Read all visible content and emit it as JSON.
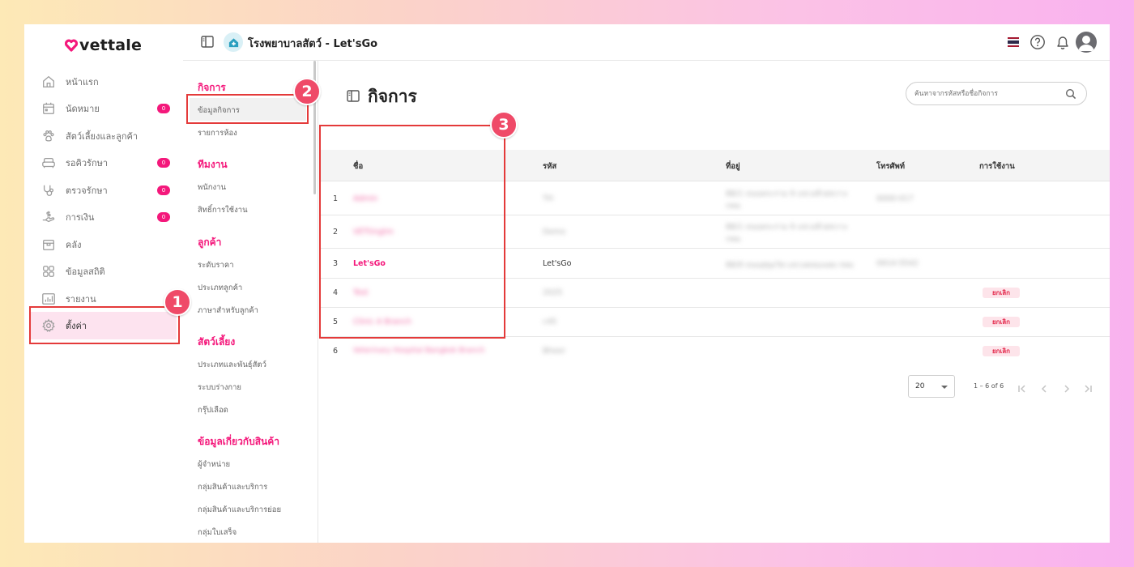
{
  "brand": {
    "logo_text": "vettale"
  },
  "nav": {
    "items": [
      {
        "label": "หน้าแรก",
        "icon": "home-icon"
      },
      {
        "label": "นัดหมาย",
        "icon": "calendar-icon",
        "badge": "0"
      },
      {
        "label": "สัตว์เลี้ยงและลูกค้า",
        "icon": "paw-icon"
      },
      {
        "label": "รอคิวรักษา",
        "icon": "sofa-icon",
        "badge": "0"
      },
      {
        "label": "ตรวจรักษา",
        "icon": "stethoscope-icon",
        "badge": "0"
      },
      {
        "label": "การเงิน",
        "icon": "money-hand-icon",
        "badge": "0"
      },
      {
        "label": "คลัง",
        "icon": "box-icon"
      },
      {
        "label": "ข้อมูลสถิติ",
        "icon": "grid-icon"
      },
      {
        "label": "รายงาน",
        "icon": "bar-chart-icon"
      },
      {
        "label": "ตั้งค่า",
        "icon": "gear-icon"
      }
    ]
  },
  "topbar": {
    "clinic_title": "โรงพยาบาลสัตว์ - Let'sGo"
  },
  "submenu": {
    "sections": [
      {
        "title": "กิจการ",
        "items": [
          "ข้อมูลกิจการ",
          "รายการห้อง"
        ]
      },
      {
        "title": "ทีมงาน",
        "items": [
          "พนักงาน",
          "สิทธิ์การใช้งาน"
        ]
      },
      {
        "title": "ลูกค้า",
        "items": [
          "ระดับราคา",
          "ประเภทลูกค้า",
          "ภาษาสำหรับลูกค้า"
        ]
      },
      {
        "title": "สัตว์เลี้ยง",
        "items": [
          "ประเภทและพันธุ์สัตว์",
          "ระบบร่างกาย",
          "กรุ๊ปเลือด"
        ]
      },
      {
        "title": "ข้อมูลเกี่ยวกับสินค้า",
        "items": [
          "ผู้จำหน่าย",
          "กลุ่มสินค้าและบริการ",
          "กลุ่มสินค้าและบริการย่อย",
          "กลุ่มใบเสร็จ"
        ]
      }
    ]
  },
  "main": {
    "title": "กิจการ",
    "search_placeholder": "ค้นหาจากรหัสหรือชื่อกิจการ",
    "columns": [
      "ชื่อ",
      "รหัส",
      "ที่อยู่",
      "โทรศัพท์",
      "การใช้งาน"
    ],
    "rows": [
      {
        "no": "1",
        "name": "Admin",
        "code": "TH",
        "address": "88/1 ถนนพระราม 9 แขวงห้วยขวาง",
        "address2": "กทม",
        "phone": "0000-017",
        "status": ""
      },
      {
        "no": "2",
        "name": "VETtingtm",
        "code": "Demo",
        "address": "88/1 ถนนพระราม 9 แขวงห้วยขวาง",
        "address2": "กทม",
        "phone": "",
        "status": ""
      },
      {
        "no": "3",
        "name": "Let'sGo",
        "code": "Let'sGo",
        "address": "88/9 ถนนสุขุมวิท แขวงคลองเตย กทม",
        "address2": "",
        "phone": "0914-5542",
        "status": ""
      },
      {
        "no": "4",
        "name": "Test",
        "code": "2025",
        "address": "",
        "address2": "",
        "phone": "",
        "status": "ยกเลิก"
      },
      {
        "no": "5",
        "name": "Clinic A Branch",
        "code": "c45",
        "address": "",
        "address2": "",
        "phone": "",
        "status": "ยกเลิก"
      },
      {
        "no": "6",
        "name": "Veterinary Hospital Bangkok Branch",
        "code": "Bheer",
        "address": "",
        "address2": "",
        "phone": "",
        "status": "ยกเลิก"
      }
    ],
    "pager": {
      "page_size": "20",
      "range": "1 – 6 of 6"
    }
  },
  "callouts": [
    "1",
    "2",
    "3"
  ],
  "colors": {
    "accent": "#f4187b",
    "highlight": "#e43a3a",
    "badge_bg": "#ef4a68"
  }
}
